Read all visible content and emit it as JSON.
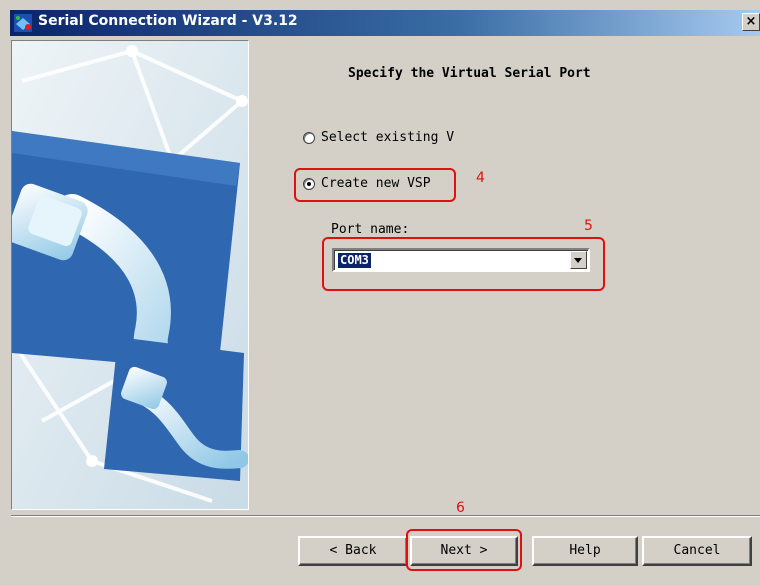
{
  "window": {
    "title": "Serial Connection Wizard - V3.12",
    "close_glyph": "×"
  },
  "page": {
    "heading": "Specify the Virtual Serial Port"
  },
  "options": {
    "existing_label": "Select existing V",
    "create_label": "Create new VSP",
    "selected": "create"
  },
  "port": {
    "label": "Port name:",
    "value": "COM3"
  },
  "annotations": {
    "step_create": "4",
    "step_port": "5",
    "step_next": "6",
    "color": "#e01010"
  },
  "buttons": {
    "back": "< Back",
    "next": "Next >",
    "help": "Help",
    "cancel": "Cancel"
  },
  "colors": {
    "title_bar": "#0a246a",
    "face": "#d4d0c8",
    "selection": "#0a246a"
  },
  "icons": [
    "app-icon",
    "close-icon",
    "radio-icon",
    "dropdown-arrow-icon",
    "serial-cable-illustration"
  ]
}
